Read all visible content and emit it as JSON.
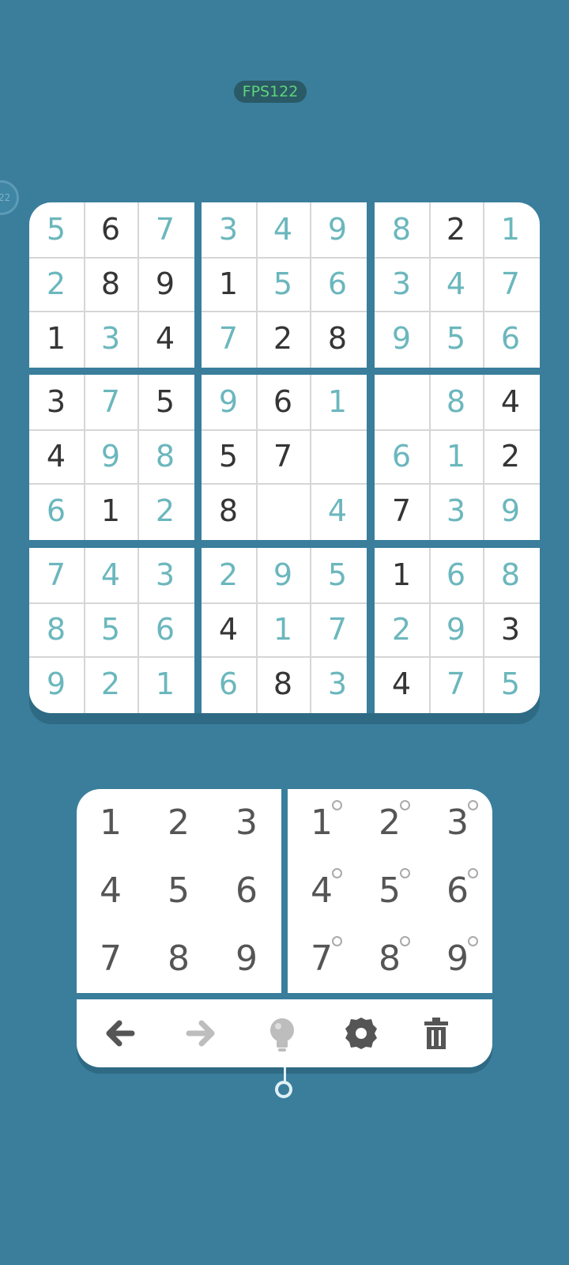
{
  "status": {
    "fps_label": "FPS122",
    "timer_text": "22"
  },
  "board": {
    "rows": [
      [
        "5",
        "6",
        "7",
        "3",
        "4",
        "9",
        "8",
        "2",
        "1"
      ],
      [
        "2",
        "8",
        "9",
        "1",
        "5",
        "6",
        "3",
        "4",
        "7"
      ],
      [
        "1",
        "3",
        "4",
        "7",
        "2",
        "8",
        "9",
        "5",
        "6"
      ],
      [
        "3",
        "7",
        "5",
        "9",
        "6",
        "1",
        "",
        "8",
        "4"
      ],
      [
        "4",
        "9",
        "8",
        "5",
        "7",
        "",
        "6",
        "1",
        "2"
      ],
      [
        "6",
        "1",
        "2",
        "8",
        "",
        "4",
        "7",
        "3",
        "9"
      ],
      [
        "7",
        "4",
        "3",
        "2",
        "9",
        "5",
        "1",
        "6",
        "8"
      ],
      [
        "8",
        "5",
        "6",
        "4",
        "1",
        "7",
        "2",
        "9",
        "3"
      ],
      [
        "9",
        "2",
        "1",
        "6",
        "8",
        "3",
        "4",
        "7",
        "5"
      ]
    ],
    "kinds": [
      [
        "f",
        "g",
        "f",
        "f",
        "f",
        "f",
        "f",
        "g",
        "f"
      ],
      [
        "f",
        "g",
        "g",
        "g",
        "f",
        "f",
        "f",
        "f",
        "f"
      ],
      [
        "g",
        "f",
        "g",
        "f",
        "g",
        "g",
        "f",
        "f",
        "f"
      ],
      [
        "g",
        "f",
        "g",
        "f",
        "g",
        "f",
        "",
        "f",
        "g"
      ],
      [
        "g",
        "f",
        "f",
        "g",
        "g",
        "",
        "f",
        "f",
        "g"
      ],
      [
        "f",
        "g",
        "f",
        "g",
        "",
        "f",
        "g",
        "f",
        "f"
      ],
      [
        "f",
        "f",
        "f",
        "f",
        "f",
        "f",
        "g",
        "f",
        "f"
      ],
      [
        "f",
        "f",
        "f",
        "g",
        "f",
        "f",
        "f",
        "f",
        "g"
      ],
      [
        "f",
        "f",
        "f",
        "f",
        "g",
        "f",
        "g",
        "f",
        "f"
      ]
    ],
    "colors": {
      "given": "#353535",
      "filled": "#6bb7bd"
    }
  },
  "numpad": {
    "digits": [
      "1",
      "2",
      "3",
      "4",
      "5",
      "6",
      "7",
      "8",
      "9"
    ],
    "note_digits": [
      "1",
      "2",
      "3",
      "4",
      "5",
      "6",
      "7",
      "8",
      "9"
    ]
  },
  "toolbar": {
    "tools": [
      {
        "icon": "undo-arrow-icon",
        "enabled": true
      },
      {
        "icon": "redo-arrow-icon",
        "enabled": false
      },
      {
        "icon": "lightbulb-hint-icon",
        "enabled": false
      },
      {
        "icon": "gear-settings-icon",
        "enabled": true
      },
      {
        "icon": "trash-icon",
        "enabled": true
      }
    ]
  },
  "colors": {
    "background": "#3a7e9c",
    "accent": "#6bb7bd",
    "fps_text": "#5fd37a"
  }
}
